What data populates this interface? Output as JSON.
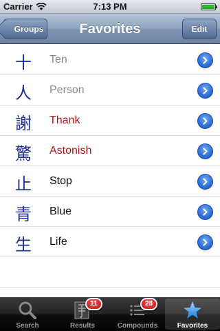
{
  "status_bar": {
    "carrier": "Carrier",
    "time": "7:13 PM"
  },
  "nav": {
    "back_label": "Groups",
    "title": "Favorites",
    "edit_label": "Edit"
  },
  "list": [
    {
      "kanji": "十",
      "meaning": "Ten",
      "color": "#888888"
    },
    {
      "kanji": "人",
      "meaning": "Person",
      "color": "#888888"
    },
    {
      "kanji": "謝",
      "meaning": "Thank",
      "color": "#b21515"
    },
    {
      "kanji": "驚",
      "meaning": "Astonish",
      "color": "#b21515"
    },
    {
      "kanji": "止",
      "meaning": "Stop",
      "color": "#111111"
    },
    {
      "kanji": "青",
      "meaning": "Blue",
      "color": "#111111"
    },
    {
      "kanji": "生",
      "meaning": "Life",
      "color": "#111111"
    }
  ],
  "tabs": [
    {
      "label": "Search",
      "icon": "search-icon",
      "badge": null
    },
    {
      "label": "Results",
      "icon": "kanji-character-icon",
      "badge": "11"
    },
    {
      "label": "Compounds",
      "icon": "list-icon",
      "badge": "28"
    },
    {
      "label": "Favorites",
      "icon": "star-icon",
      "badge": null,
      "active": true
    }
  ],
  "kanji_color": "#1f2f9a",
  "accent": "#2d6fd6"
}
